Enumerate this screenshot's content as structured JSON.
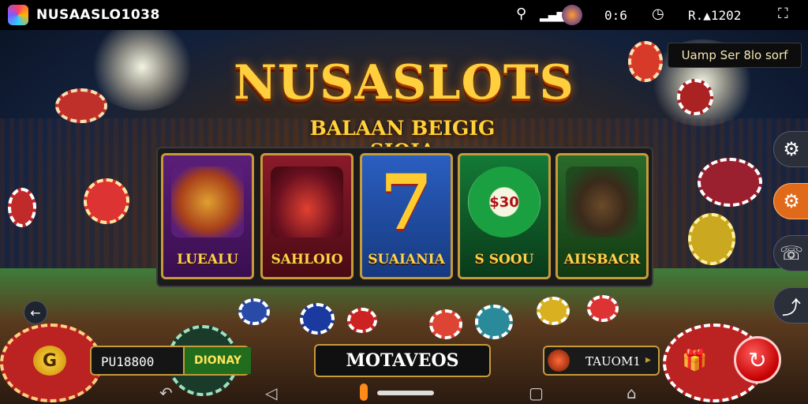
{
  "status_bar": {
    "app_name": "NUSAASLO1038",
    "time": "0:6",
    "network_text": "R.▲1202",
    "icons": [
      "app-logo-icon",
      "search-icon",
      "signal-icon",
      "avatar-icon",
      "clock-icon",
      "screen-record-icon"
    ]
  },
  "promo": {
    "label": "Uamp Ser 8lo sorf"
  },
  "hero": {
    "title": "NUSASLOTS",
    "subtitle": "BALAAN BEIGIG SIOIA"
  },
  "games": [
    {
      "label": "LUEALU",
      "art": "treasure-barrel",
      "color": "#4a1660"
    },
    {
      "label": "SAHLOIO",
      "art": "motorbike-rider",
      "color": "#6a1020"
    },
    {
      "label": "SUAIANIA",
      "art": "lucky-seven",
      "color": "#1e4ea8"
    },
    {
      "label": "S SOOU",
      "art": "green-chip",
      "color": "#0f5a2a"
    },
    {
      "label": "AIISBACR",
      "art": "horse-rider",
      "color": "#1e4a1e"
    }
  ],
  "side_menu": [
    {
      "icon": "gear-icon",
      "active": false
    },
    {
      "icon": "settings-active-icon",
      "active": true
    },
    {
      "icon": "chat-icon",
      "active": false
    },
    {
      "icon": "share-icon",
      "active": false
    }
  ],
  "bottom_bar": {
    "coin_symbol": "G",
    "balance": "PU18800",
    "deposit_label": "DIONAY",
    "main_button": "MOTAVEOS",
    "username": "TAUOM1",
    "spin_symbol": "↻"
  },
  "colors": {
    "gold": "#c79a3a",
    "accent_orange": "#e06a1a",
    "spin_red": "#c40000"
  }
}
